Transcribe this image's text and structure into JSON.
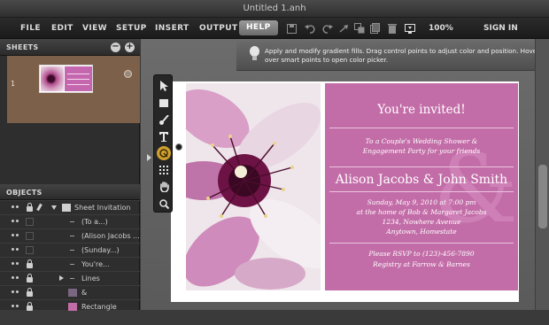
{
  "app": {
    "window_title": "Untitled 1.anh"
  },
  "menubar": {
    "items": [
      "FILE",
      "EDIT",
      "VIEW",
      "SETUP",
      "INSERT",
      "OUTPUT",
      "HELP"
    ],
    "zoom": "100%",
    "signin": "SIGN IN",
    "toolbar_icons": [
      "save-icon",
      "undo-icon",
      "redo-icon",
      "redo-all-icon",
      "duplicate-icon",
      "copy-icon",
      "trash-icon",
      "preview-icon"
    ]
  },
  "sheets_panel": {
    "title": "SHEETS",
    "rows": [
      {
        "number": "1",
        "selected": true
      }
    ]
  },
  "objects_panel": {
    "title": "OBJECTS",
    "rows": [
      {
        "label": "Sheet Invitation",
        "kind": "folder",
        "locked": true
      },
      {
        "label": "(To a...)",
        "kind": "text",
        "locked": false
      },
      {
        "label": "(Alison Jacobs ...",
        "kind": "text",
        "locked": false
      },
      {
        "label": "(Sunday...)",
        "kind": "text",
        "locked": false
      },
      {
        "label": "You're...",
        "kind": "text",
        "locked": true
      },
      {
        "label": "Lines",
        "kind": "group",
        "locked": true
      },
      {
        "label": "&",
        "kind": "text",
        "locked": true
      },
      {
        "label": "Rectangle",
        "kind": "shape",
        "locked": true
      }
    ]
  },
  "help_tip": {
    "text": "Apply and modify gradient fills. Drag control points to adjust color and position. Hover over smart points to open color picker."
  },
  "card": {
    "headline": "You're invited!",
    "line1": "To a Couple's Wedding Shower &",
    "line2": "Engagement Party for your friends",
    "names": "Alison Jacobs  &  John Smith",
    "date": "Sunday, May 9, 2010 at 7:00 pm",
    "place1": "at the home of Bob & Margaret Jacobs",
    "place2": "1234, Nowhere Avenue",
    "place3": "Anytown, Homestate",
    "rsvp": "Please RSVP to (123)-456-7890",
    "registry": "Registry at Farrow & Barnes",
    "ampersand": "&"
  },
  "tools": [
    "pointer-tool",
    "rectangle-tool",
    "brush-tool",
    "text-tool",
    "gradient-tool",
    "grid-tool",
    "hand-tool",
    "zoom-tool"
  ],
  "colors": {
    "accent": "#c36da8",
    "selected_sheet": "#7d6049",
    "active_tool": "#cfa02e"
  }
}
